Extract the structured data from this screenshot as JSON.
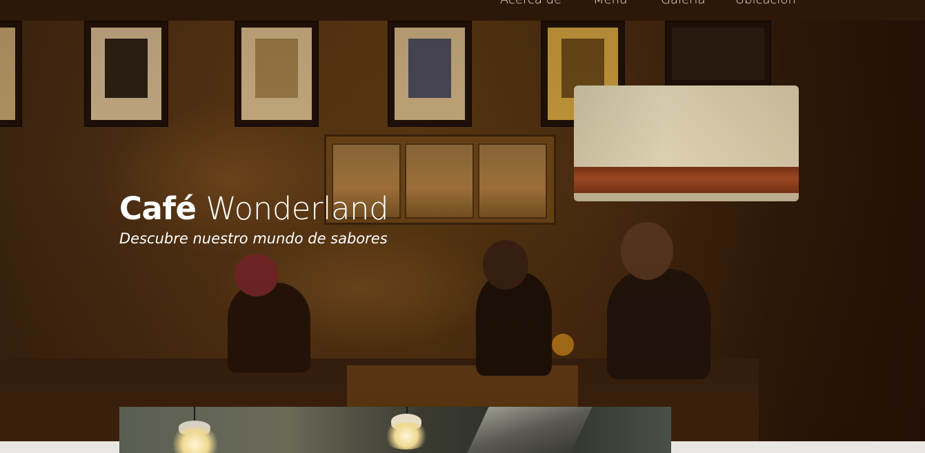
{
  "nav": {
    "items": [
      {
        "label": "Acerca de"
      },
      {
        "label": "Menú"
      },
      {
        "label": "Galería"
      },
      {
        "label": "Ubicación"
      }
    ]
  },
  "hero": {
    "title_bold": "Café",
    "title_light": "Wonderland",
    "subtitle": "Descubre nuestro mundo de sabores",
    "image_icon": "cafe-interior-photo"
  },
  "gallery": {
    "image_icon": "cafe-pendant-lamps-photo"
  },
  "colors": {
    "nav_background": "#2d1708",
    "hero_text": "#ffffff",
    "page_background": "#efeeec"
  }
}
